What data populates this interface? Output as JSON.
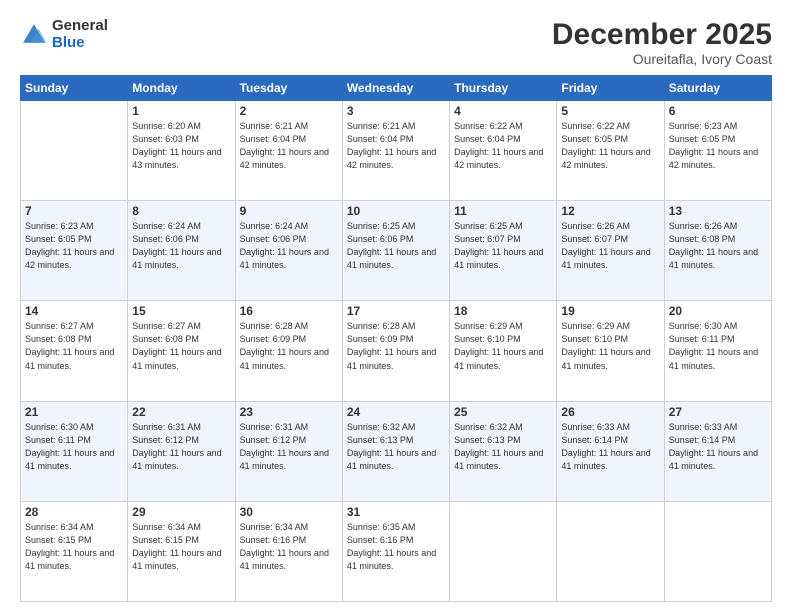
{
  "header": {
    "logo_general": "General",
    "logo_blue": "Blue",
    "title": "December 2025",
    "subtitle": "Oureitafla, Ivory Coast"
  },
  "weekdays": [
    "Sunday",
    "Monday",
    "Tuesday",
    "Wednesday",
    "Thursday",
    "Friday",
    "Saturday"
  ],
  "rows": [
    {
      "cells": [
        {
          "day": "",
          "empty": true
        },
        {
          "day": "1",
          "sunrise": "6:20 AM",
          "sunset": "6:03 PM",
          "daylight": "11 hours and 43 minutes."
        },
        {
          "day": "2",
          "sunrise": "6:21 AM",
          "sunset": "6:04 PM",
          "daylight": "11 hours and 42 minutes."
        },
        {
          "day": "3",
          "sunrise": "6:21 AM",
          "sunset": "6:04 PM",
          "daylight": "11 hours and 42 minutes."
        },
        {
          "day": "4",
          "sunrise": "6:22 AM",
          "sunset": "6:04 PM",
          "daylight": "11 hours and 42 minutes."
        },
        {
          "day": "5",
          "sunrise": "6:22 AM",
          "sunset": "6:05 PM",
          "daylight": "11 hours and 42 minutes."
        },
        {
          "day": "6",
          "sunrise": "6:23 AM",
          "sunset": "6:05 PM",
          "daylight": "11 hours and 42 minutes."
        }
      ]
    },
    {
      "cells": [
        {
          "day": "7",
          "sunrise": "6:23 AM",
          "sunset": "6:05 PM",
          "daylight": "11 hours and 42 minutes."
        },
        {
          "day": "8",
          "sunrise": "6:24 AM",
          "sunset": "6:06 PM",
          "daylight": "11 hours and 41 minutes."
        },
        {
          "day": "9",
          "sunrise": "6:24 AM",
          "sunset": "6:06 PM",
          "daylight": "11 hours and 41 minutes."
        },
        {
          "day": "10",
          "sunrise": "6:25 AM",
          "sunset": "6:06 PM",
          "daylight": "11 hours and 41 minutes."
        },
        {
          "day": "11",
          "sunrise": "6:25 AM",
          "sunset": "6:07 PM",
          "daylight": "11 hours and 41 minutes."
        },
        {
          "day": "12",
          "sunrise": "6:26 AM",
          "sunset": "6:07 PM",
          "daylight": "11 hours and 41 minutes."
        },
        {
          "day": "13",
          "sunrise": "6:26 AM",
          "sunset": "6:08 PM",
          "daylight": "11 hours and 41 minutes."
        }
      ]
    },
    {
      "cells": [
        {
          "day": "14",
          "sunrise": "6:27 AM",
          "sunset": "6:08 PM",
          "daylight": "11 hours and 41 minutes."
        },
        {
          "day": "15",
          "sunrise": "6:27 AM",
          "sunset": "6:08 PM",
          "daylight": "11 hours and 41 minutes."
        },
        {
          "day": "16",
          "sunrise": "6:28 AM",
          "sunset": "6:09 PM",
          "daylight": "11 hours and 41 minutes."
        },
        {
          "day": "17",
          "sunrise": "6:28 AM",
          "sunset": "6:09 PM",
          "daylight": "11 hours and 41 minutes."
        },
        {
          "day": "18",
          "sunrise": "6:29 AM",
          "sunset": "6:10 PM",
          "daylight": "11 hours and 41 minutes."
        },
        {
          "day": "19",
          "sunrise": "6:29 AM",
          "sunset": "6:10 PM",
          "daylight": "11 hours and 41 minutes."
        },
        {
          "day": "20",
          "sunrise": "6:30 AM",
          "sunset": "6:11 PM",
          "daylight": "11 hours and 41 minutes."
        }
      ]
    },
    {
      "cells": [
        {
          "day": "21",
          "sunrise": "6:30 AM",
          "sunset": "6:11 PM",
          "daylight": "11 hours and 41 minutes."
        },
        {
          "day": "22",
          "sunrise": "6:31 AM",
          "sunset": "6:12 PM",
          "daylight": "11 hours and 41 minutes."
        },
        {
          "day": "23",
          "sunrise": "6:31 AM",
          "sunset": "6:12 PM",
          "daylight": "11 hours and 41 minutes."
        },
        {
          "day": "24",
          "sunrise": "6:32 AM",
          "sunset": "6:13 PM",
          "daylight": "11 hours and 41 minutes."
        },
        {
          "day": "25",
          "sunrise": "6:32 AM",
          "sunset": "6:13 PM",
          "daylight": "11 hours and 41 minutes."
        },
        {
          "day": "26",
          "sunrise": "6:33 AM",
          "sunset": "6:14 PM",
          "daylight": "11 hours and 41 minutes."
        },
        {
          "day": "27",
          "sunrise": "6:33 AM",
          "sunset": "6:14 PM",
          "daylight": "11 hours and 41 minutes."
        }
      ]
    },
    {
      "cells": [
        {
          "day": "28",
          "sunrise": "6:34 AM",
          "sunset": "6:15 PM",
          "daylight": "11 hours and 41 minutes."
        },
        {
          "day": "29",
          "sunrise": "6:34 AM",
          "sunset": "6:15 PM",
          "daylight": "11 hours and 41 minutes."
        },
        {
          "day": "30",
          "sunrise": "6:34 AM",
          "sunset": "6:16 PM",
          "daylight": "11 hours and 41 minutes."
        },
        {
          "day": "31",
          "sunrise": "6:35 AM",
          "sunset": "6:16 PM",
          "daylight": "11 hours and 41 minutes."
        },
        {
          "day": "",
          "empty": true
        },
        {
          "day": "",
          "empty": true
        },
        {
          "day": "",
          "empty": true
        }
      ]
    }
  ],
  "labels": {
    "sunrise": "Sunrise:",
    "sunset": "Sunset:",
    "daylight": "Daylight:"
  }
}
